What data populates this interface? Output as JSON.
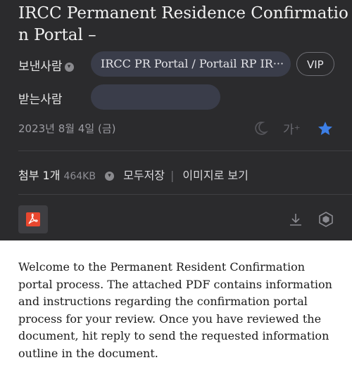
{
  "email": {
    "subject": "IRCC Permanent Residence Confirmation Portal –",
    "sender_label": "보낸사람",
    "sender_name": "IRCC PR Portal / Portail RP IR···",
    "vip_label": "VIP",
    "recipient_label": "받는사람",
    "date": "2023년 8월 4일 (금)",
    "font_size_toggle": "가⁺",
    "attachment": {
      "label": "첨부 1개",
      "size": "464KB",
      "save_all": "모두저장",
      "view_as_images": "이미지로 보기"
    },
    "body": "Welcome to the Permanent Resident Confirmation portal process. The attached PDF contains information and instructions regarding the confirmation portal process for your review. Once you have reviewed the document, hit reply to send the requested information outline in the document."
  },
  "colors": {
    "header_bg": "#2b2b2d",
    "pill_bg": "#3a3d4a",
    "star": "#3d7fe6",
    "pdf_icon": "#e8472f"
  },
  "icons": {
    "sender_expand": "chevron-down-icon",
    "dark_mode": "moon-icon",
    "star": "star-icon",
    "attachment_expand": "chevron-down-icon",
    "pdf": "pdf-icon",
    "download": "download-icon",
    "scan": "shield-icon"
  }
}
